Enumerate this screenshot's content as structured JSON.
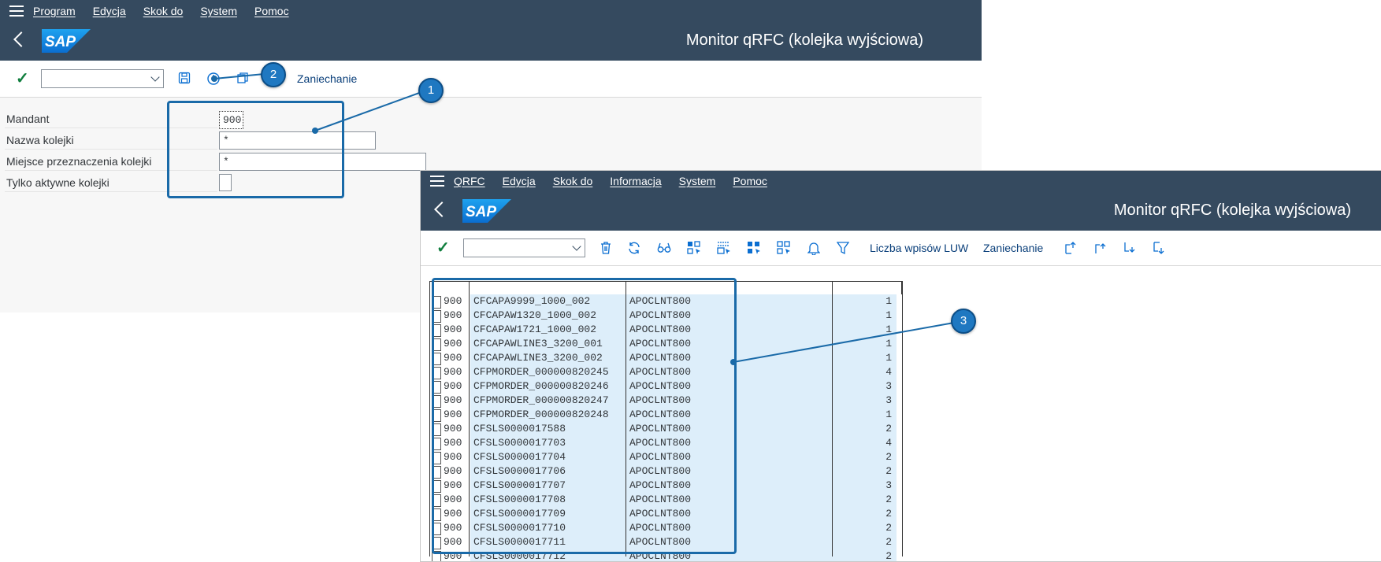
{
  "window1": {
    "menu": [
      "Program",
      "Edycja",
      "Skok do",
      "System",
      "Pomoc"
    ],
    "title": "Monitor qRFC (kolejka wyjściowa)",
    "toolbar": {
      "cancel_label": "Zaniechanie"
    },
    "form": {
      "mandant_label": "Mandant",
      "mandant_value": "900",
      "queue_name_label": "Nazwa kolejki",
      "queue_name_value": "*",
      "destination_label": "Miejsce przeznaczenia kolejki",
      "destination_value": "*",
      "active_only_label": "Tylko aktywne kolejki"
    }
  },
  "window2": {
    "menu": [
      "QRFC",
      "Edycja",
      "Skok do",
      "Informacja",
      "System",
      "Pomoc"
    ],
    "title": "Monitor qRFC (kolejka wyjściowa)",
    "toolbar": {
      "luw_label": "Liczba wpisów LUW",
      "cancel_label": "Zaniechanie"
    },
    "rows": [
      {
        "mandant": "900",
        "queue": "CFCAPA9999_1000_002",
        "dest": "APOCLNT800",
        "count": "1"
      },
      {
        "mandant": "900",
        "queue": "CFCAPAW1320_1000_002",
        "dest": "APOCLNT800",
        "count": "1"
      },
      {
        "mandant": "900",
        "queue": "CFCAPAW1721_1000_002",
        "dest": "APOCLNT800",
        "count": "1"
      },
      {
        "mandant": "900",
        "queue": "CFCAPAWLINE3_3200_001",
        "dest": "APOCLNT800",
        "count": "1"
      },
      {
        "mandant": "900",
        "queue": "CFCAPAWLINE3_3200_002",
        "dest": "APOCLNT800",
        "count": "1"
      },
      {
        "mandant": "900",
        "queue": "CFPMORDER_000000820245",
        "dest": "APOCLNT800",
        "count": "4"
      },
      {
        "mandant": "900",
        "queue": "CFPMORDER_000000820246",
        "dest": "APOCLNT800",
        "count": "3"
      },
      {
        "mandant": "900",
        "queue": "CFPMORDER_000000820247",
        "dest": "APOCLNT800",
        "count": "3"
      },
      {
        "mandant": "900",
        "queue": "CFPMORDER_000000820248",
        "dest": "APOCLNT800",
        "count": "1"
      },
      {
        "mandant": "900",
        "queue": "CFSLS0000017588",
        "dest": "APOCLNT800",
        "count": "2"
      },
      {
        "mandant": "900",
        "queue": "CFSLS0000017703",
        "dest": "APOCLNT800",
        "count": "4"
      },
      {
        "mandant": "900",
        "queue": "CFSLS0000017704",
        "dest": "APOCLNT800",
        "count": "2"
      },
      {
        "mandant": "900",
        "queue": "CFSLS0000017706",
        "dest": "APOCLNT800",
        "count": "2"
      },
      {
        "mandant": "900",
        "queue": "CFSLS0000017707",
        "dest": "APOCLNT800",
        "count": "3"
      },
      {
        "mandant": "900",
        "queue": "CFSLS0000017708",
        "dest": "APOCLNT800",
        "count": "2"
      },
      {
        "mandant": "900",
        "queue": "CFSLS0000017709",
        "dest": "APOCLNT800",
        "count": "2"
      },
      {
        "mandant": "900",
        "queue": "CFSLS0000017710",
        "dest": "APOCLNT800",
        "count": "2"
      },
      {
        "mandant": "900",
        "queue": "CFSLS0000017711",
        "dest": "APOCLNT800",
        "count": "2"
      },
      {
        "mandant": "900",
        "queue": "CFSLS0000017712",
        "dest": "APOCLNT800",
        "count": "2"
      }
    ]
  },
  "callouts": [
    "1",
    "2",
    "3"
  ],
  "colors": {
    "shell": "#354a5f",
    "accent": "#0a6ed1",
    "callout": "#1f78c1",
    "row_highlight": "#ddeefa",
    "check": "#107e3e"
  }
}
